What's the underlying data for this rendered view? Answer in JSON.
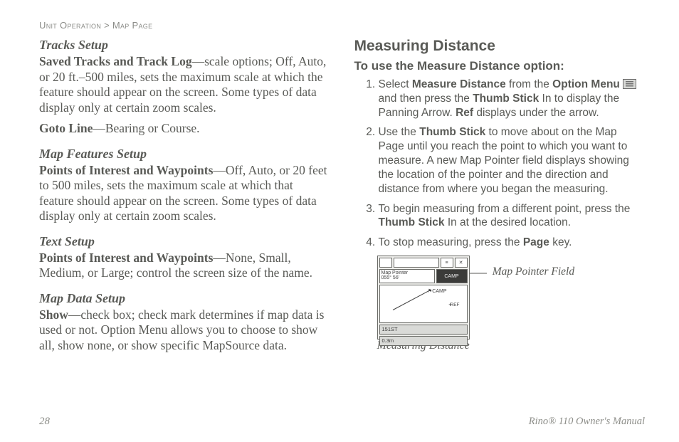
{
  "breadcrumb": {
    "part1": "Unit Operation",
    "sep": " > ",
    "part2": "Map Page"
  },
  "left": {
    "sections": [
      {
        "heading": "Tracks Setup",
        "paras": [
          {
            "lead": "Saved Tracks and Track Log",
            "text": "—scale options; Off, Auto, or 20 ft.–500 miles, sets the maximum scale at which the feature should appear on the screen. Some types of data display only at certain zoom scales."
          },
          {
            "lead": "Goto Line",
            "text": "—Bearing or Course."
          }
        ]
      },
      {
        "heading": "Map Features Setup",
        "paras": [
          {
            "lead": "Points of Interest and Waypoints",
            "text": "—Off, Auto, or 20 feet to 500 miles, sets the maximum scale at which that feature should appear on the screen. Some types of data display only at certain zoom scales."
          }
        ]
      },
      {
        "heading": "Text Setup",
        "paras": [
          {
            "lead": "Points of Interest and Waypoints",
            "text": "—None, Small, Medium, or Large; control the screen size of the name."
          }
        ]
      },
      {
        "heading": "Map Data Setup",
        "paras": [
          {
            "lead": "Show",
            "text": "—check box; check mark determines if map data is used or not. Option Menu allows you to choose to show all, show none, or show specific MapSource data."
          }
        ]
      }
    ]
  },
  "right": {
    "title": "Measuring Distance",
    "subtitle": "To use the Measure Distance option:",
    "steps": [
      {
        "pre": "Select ",
        "b1": "Measure Distance",
        "mid1": " from the ",
        "b2": "Option Menu",
        "post_icon": " and then press the ",
        "b3": "Thumb Stick",
        "mid2": " In to display the Panning Arrow. ",
        "b4": "Ref",
        "tail": " displays under the arrow."
      },
      {
        "pre": "Use the ",
        "b1": "Thumb Stick",
        "tail": " to move about on the Map Page until you reach the point to which you want to measure. A new Map Pointer field displays showing the location of the pointer and the direction and distance from where you began the measuring."
      },
      {
        "pre": "To begin measuring from a different point, press the ",
        "b1": "Thumb Stick",
        "tail": " In at the desired location."
      },
      {
        "pre": "To stop measuring, press the ",
        "b1": "Page",
        "tail": " key."
      }
    ],
    "figure": {
      "pointer_label": "Map Pointer Field",
      "caption": "Measuring Distance",
      "ss": {
        "row1_center": " ",
        "row2_left_line1": "Map Pointer",
        "row2_left_line2": "055° 56'",
        "row2_right": "CAMP",
        "flag": "⚑CAMP",
        "ref": "REF",
        "bottom1": "151ST",
        "bottom2": "0.3m"
      }
    }
  },
  "footer": {
    "page_number": "28",
    "manual": "Rino® 110 Owner's Manual"
  }
}
